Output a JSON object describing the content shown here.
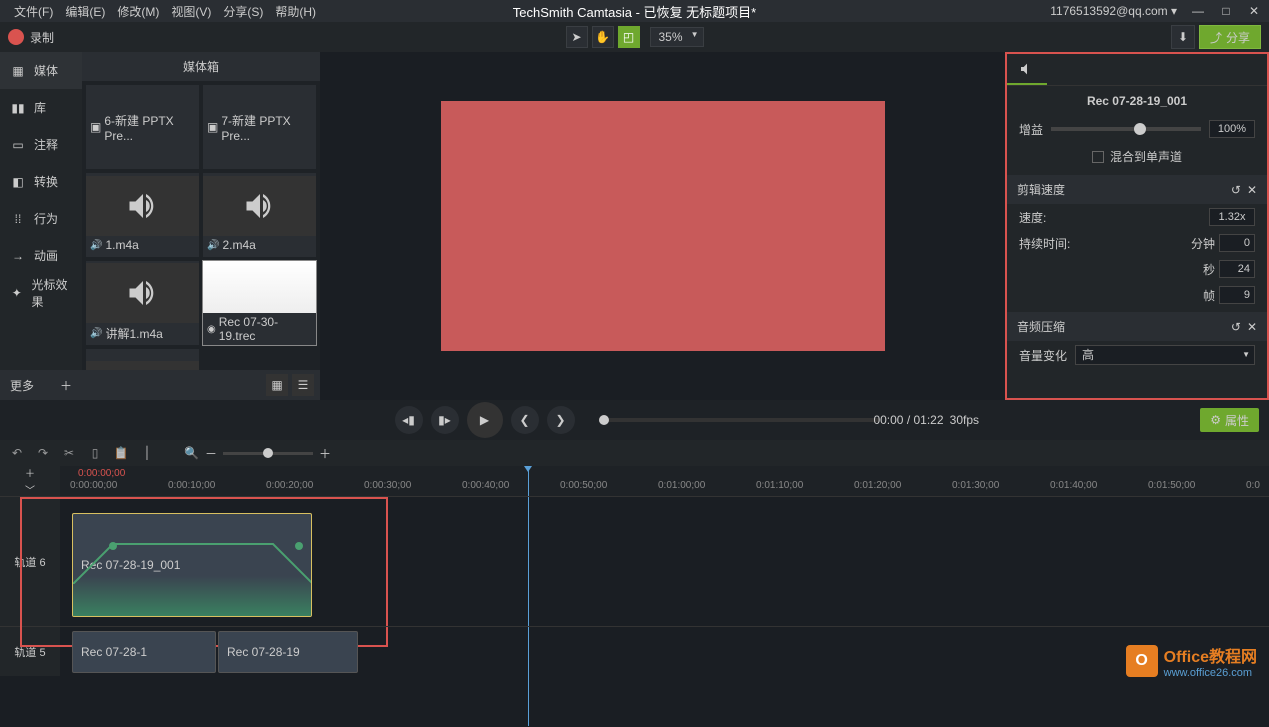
{
  "menubar": {
    "items": [
      "文件(F)",
      "编辑(E)",
      "修改(M)",
      "视图(V)",
      "分享(S)",
      "帮助(H)"
    ],
    "title": "TechSmith Camtasia - 已恢复 无标题项目*",
    "account": "1176513592@qq.com ▾"
  },
  "toolbar": {
    "record": "录制",
    "zoom": "35%",
    "share": "分享"
  },
  "side_tabs": [
    "媒体",
    "库",
    "注释",
    "转换",
    "行为",
    "动画",
    "光标效果"
  ],
  "side_more": "更多",
  "media": {
    "title": "媒体箱",
    "items": [
      {
        "label": "6-新建 PPTX Pre..."
      },
      {
        "label": "7-新建 PPTX Pre..."
      },
      {
        "label": "1.m4a"
      },
      {
        "label": "2.m4a"
      },
      {
        "label": "讲解1.m4a"
      },
      {
        "label": "Rec 07-30-19.trec"
      },
      {
        "label": ""
      }
    ]
  },
  "playback": {
    "time": "00:00 / 01:22",
    "fps": "30fps"
  },
  "props_btn": "属性",
  "right_panel": {
    "clip_name": "Rec 07-28-19_001",
    "gain": {
      "label": "增益",
      "value": "100%"
    },
    "mono": "混合到单声道",
    "speed_section": "剪辑速度",
    "speed": {
      "label": "速度:",
      "value": "1.32x"
    },
    "duration": {
      "label": "持续时间:",
      "min_label": "分钟",
      "min": "0",
      "sec_label": "秒",
      "sec": "24",
      "frame_label": "帧",
      "frame": "9"
    },
    "compress_section": "音频压缩",
    "volume": {
      "label": "音量变化",
      "value": "高"
    }
  },
  "timeline": {
    "playhead": "0:00:00;00",
    "ticks": [
      "0:00:00;00",
      "0:00:10;00",
      "0:00:20;00",
      "0:00:30;00",
      "0:00:40;00",
      "0:00:50;00",
      "0:01:00;00",
      "0:01:10;00",
      "0:01:20;00",
      "0:01:30;00",
      "0:01:40;00",
      "0:01:50;00",
      "0:0"
    ],
    "track6": "轨道 6",
    "track5": "轨道 5",
    "clip6": "Rec 07-28-19_001",
    "clip5a": "Rec 07-28-1",
    "clip5b": "Rec 07-28-19"
  },
  "watermark": {
    "brand": "Office教程网",
    "url": "www.office26.com"
  }
}
